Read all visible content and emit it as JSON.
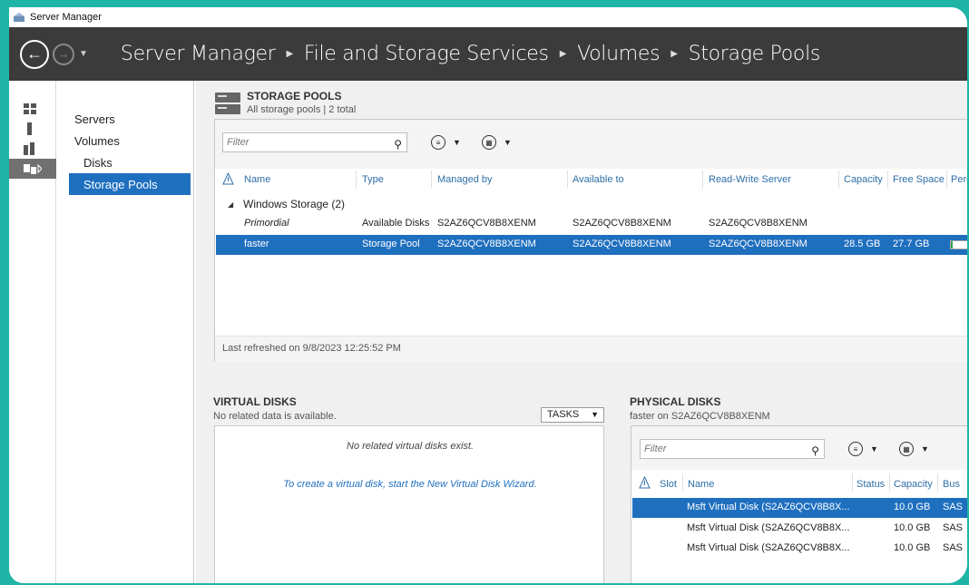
{
  "window": {
    "title": "Server Manager"
  },
  "header": {
    "breadcrumb": [
      "Server Manager",
      "File and Storage Services",
      "Volumes",
      "Storage Pools"
    ]
  },
  "nav": {
    "items": [
      {
        "label": "Servers"
      },
      {
        "label": "Volumes"
      },
      {
        "label": "Disks"
      },
      {
        "label": "Storage Pools"
      }
    ]
  },
  "storage_pools": {
    "title": "STORAGE POOLS",
    "subtitle": "All storage pools | 2 total",
    "filter_placeholder": "Filter",
    "columns": [
      "Name",
      "Type",
      "Managed by",
      "Available to",
      "Read-Write Server",
      "Capacity",
      "Free Space",
      "Perc"
    ],
    "group_label": "Windows Storage (2)",
    "rows": [
      {
        "name": "Primordial",
        "type": "Available Disks",
        "managed_by": "S2AZ6QCV8B8XENM",
        "available_to": "S2AZ6QCV8B8XENM",
        "rw_server": "S2AZ6QCV8B8XENM",
        "capacity": "",
        "free_space": ""
      },
      {
        "name": "faster",
        "type": "Storage Pool",
        "managed_by": "S2AZ6QCV8B8XENM",
        "available_to": "S2AZ6QCV8B8XENM",
        "rw_server": "S2AZ6QCV8B8XENM",
        "capacity": "28.5 GB",
        "free_space": "27.7 GB"
      }
    ],
    "last_refreshed": "Last refreshed on 9/8/2023 12:25:52 PM"
  },
  "virtual_disks": {
    "title": "VIRTUAL DISKS",
    "subtitle": "No related data is available.",
    "tasks_label": "TASKS",
    "empty_message": "No related virtual disks exist.",
    "wizard_link": "To create a virtual disk, start the New Virtual Disk Wizard."
  },
  "physical_disks": {
    "title": "PHYSICAL DISKS",
    "subtitle": "faster on S2AZ6QCV8B8XENM",
    "filter_placeholder": "Filter",
    "columns": [
      "Slot",
      "Name",
      "Status",
      "Capacity",
      "Bus"
    ],
    "rows": [
      {
        "name": "Msft Virtual Disk (S2AZ6QCV8B8X...",
        "capacity": "10.0 GB",
        "bus": "SAS"
      },
      {
        "name": "Msft Virtual Disk (S2AZ6QCV8B8X...",
        "capacity": "10.0 GB",
        "bus": "SAS"
      },
      {
        "name": "Msft Virtual Disk (S2AZ6QCV8B8X...",
        "capacity": "10.0 GB",
        "bus": "SAS"
      }
    ]
  },
  "colors": {
    "accent": "#1f6fbf",
    "header_bg": "#3b3b3b",
    "frame": "#1fb5a6"
  },
  "icons": [
    "back-arrow-icon",
    "forward-arrow-icon",
    "dashboard-icon",
    "local-server-icon",
    "all-servers-icon",
    "file-storage-icon",
    "search-icon",
    "list-options-icon",
    "save-query-icon",
    "warning-column-icon"
  ]
}
